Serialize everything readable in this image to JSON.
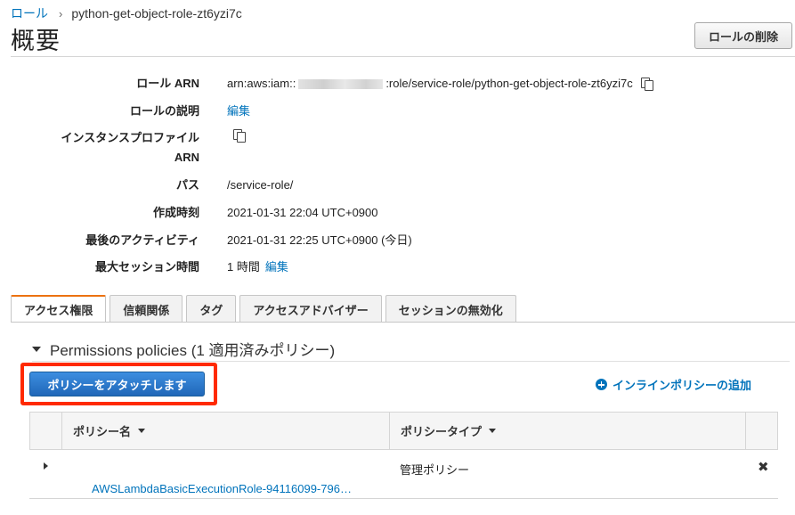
{
  "breadcrumb": {
    "parent": "ロール",
    "separator": "›",
    "current": "python-get-object-role-zt6yzi7c"
  },
  "page_title": "概要",
  "delete_button": "ロールの削除",
  "summary": {
    "role_arn": {
      "label": "ロール ARN",
      "prefix": "arn:aws:iam::",
      "suffix": ":role/service-role/python-get-object-role-zt6yzi7c"
    },
    "description": {
      "label": "ロールの説明",
      "link": "編集"
    },
    "instance_profile": {
      "label_line1": "インスタンスプロファイル",
      "label_line2": "ARN"
    },
    "path": {
      "label": "パス",
      "value": "/service-role/"
    },
    "created": {
      "label": "作成時刻",
      "value": "2021-01-31 22:04 UTC+0900"
    },
    "last_activity": {
      "label": "最後のアクティビティ",
      "value": "2021-01-31 22:25 UTC+0900 (今日)"
    },
    "max_session": {
      "label": "最大セッション時間",
      "value": "1 時間",
      "link": "編集"
    }
  },
  "tabs": [
    {
      "label": "アクセス権限",
      "active": true
    },
    {
      "label": "信頼関係",
      "active": false
    },
    {
      "label": "タグ",
      "active": false
    },
    {
      "label": "アクセスアドバイザー",
      "active": false
    },
    {
      "label": "セッションの無効化",
      "active": false
    }
  ],
  "permissions": {
    "section_title": "Permissions policies (1 適用済みポリシー)",
    "attach_button": "ポリシーをアタッチします",
    "inline_policy_link": "インラインポリシーの追加",
    "table": {
      "headers": {
        "name": "ポリシー名",
        "type": "ポリシータイプ"
      },
      "rows": [
        {
          "name": "AWSLambdaBasicExecutionRole-94116099-796…",
          "type": "管理ポリシー"
        }
      ]
    }
  },
  "colors": {
    "link": "#0073bb",
    "active_tab_accent": "#ec7211",
    "primary_button": "#2067b8",
    "highlight": "#ff2a00"
  }
}
